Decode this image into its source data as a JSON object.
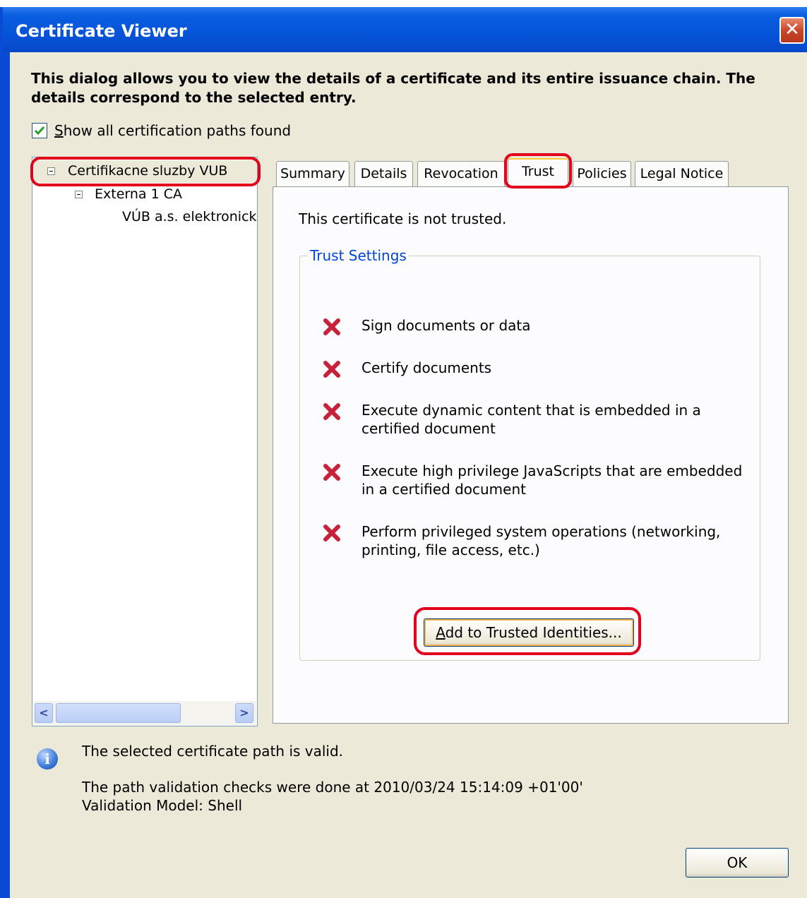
{
  "window": {
    "title": "Certificate Viewer",
    "close_symbol": "✕"
  },
  "description": "This dialog allows you to view the details of a certificate and its entire issuance chain. The details correspond to the selected entry.",
  "show_all_paths": {
    "label_prefix": "S",
    "label_rest": "how all certification paths found",
    "checked": true
  },
  "tree": {
    "items": [
      {
        "label": "Certifikacne sluzby VUB",
        "expanded": true,
        "selected": true
      },
      {
        "label": "Externa 1 CA",
        "expanded": true
      },
      {
        "label": "VÚB a.s. elektronick"
      }
    ],
    "scroll_left": "<",
    "scroll_right": ">"
  },
  "tabs": [
    {
      "label": "Summary"
    },
    {
      "label": "Details"
    },
    {
      "label": "Revocation"
    },
    {
      "label": "Trust",
      "active": true
    },
    {
      "label": "Policies"
    },
    {
      "label": "Legal Notice"
    }
  ],
  "trust": {
    "status": "This certificate is not trusted.",
    "group_label": "Trust Settings",
    "permissions": [
      {
        "line1": "Sign documents or data",
        "line2": "",
        "allowed": false
      },
      {
        "line1": "Certify documents",
        "line2": "",
        "allowed": false
      },
      {
        "line1": "Execute dynamic content that is embedded in a",
        "line2": "certified document",
        "allowed": false
      },
      {
        "line1": "Execute high privilege JavaScripts that are embedded",
        "line2": "in a certified document",
        "allowed": false
      },
      {
        "line1": "Perform privileged system operations (networking,",
        "line2": "printing, file access, etc.)",
        "allowed": false
      }
    ],
    "add_button_prefix": "A",
    "add_button_rest": "dd to Trusted Identities..."
  },
  "validation": {
    "path_status": "The selected certificate path is valid.",
    "checks_line": "The path validation checks were done at 2010/03/24 15:14:09 +01'00'",
    "model_line": "Validation Model: Shell"
  },
  "ok_label": "OK",
  "colors": {
    "title_bar": "#0654d8",
    "dialog_bg": "#ece9d8",
    "highlight_ring": "#e3001b",
    "group_label": "#0046d5",
    "deny_icon": "#c8213a"
  },
  "icons": {
    "close": "close-icon",
    "check": "checkmark-icon",
    "deny": "red-x-icon",
    "info": "info-icon"
  }
}
